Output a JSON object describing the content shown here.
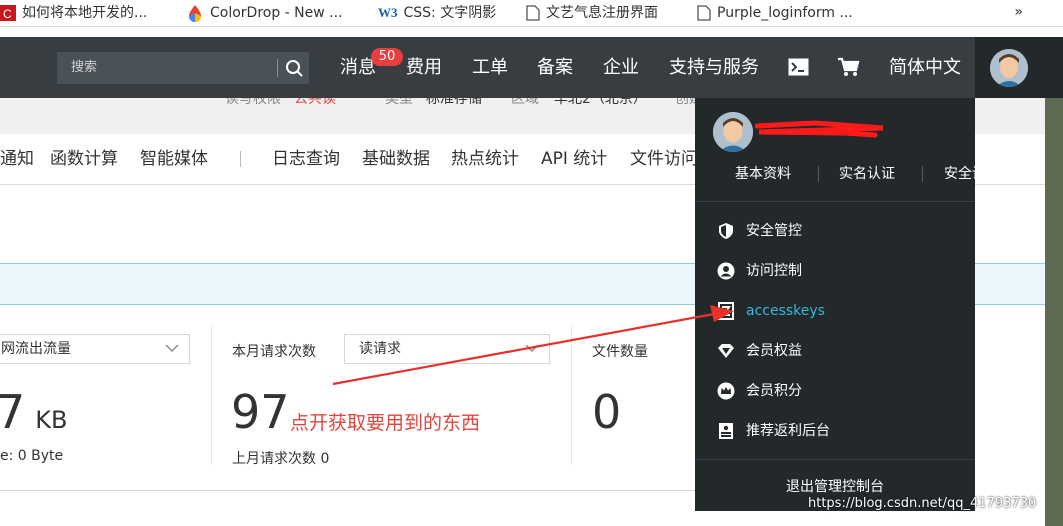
{
  "bookmarks": [
    {
      "label": "如何将本地开发的...",
      "icon": "csdn-icon"
    },
    {
      "label": "ColorDrop - New ...",
      "icon": "colordrop-icon"
    },
    {
      "label": "CSS: 文字阴影",
      "icon": "w3-icon",
      "icon_text": "W3"
    },
    {
      "label": "文艺气息注册界面",
      "icon": "page-icon"
    },
    {
      "label": "Purple_loginform ...",
      "icon": "page-icon"
    }
  ],
  "bookmarks_more": "»",
  "nav": {
    "search_placeholder": "搜索",
    "items": [
      "消息",
      "费用",
      "工单",
      "备案",
      "企业",
      "支持与服务"
    ],
    "badge": "50",
    "language": "简体中文"
  },
  "subinfo": [
    "读写权限",
    "公共读",
    "类型",
    "标准存储",
    "区域",
    "华北2（北京）",
    "创建"
  ],
  "tabs": [
    "通知",
    "函数计算",
    "智能媒体",
    "日志查询",
    "基础数据",
    "热点统计",
    "API 统计",
    "文件访问"
  ],
  "stats": {
    "traffic_select": "网流出流量",
    "traffic_value": "7",
    "traffic_unit": "KB",
    "traffic_sub": "e:  0 Byte",
    "requests_label": "本月请求次数",
    "requests_select": "读请求",
    "requests_value": "97",
    "requests_sub": "上月请求次数  0",
    "files_label": "文件数量",
    "files_value": "0"
  },
  "annotation": "点开获取要用到的东西",
  "dropdown": {
    "links": [
      "基本资料",
      "实名认证",
      "安全设置"
    ],
    "items": [
      {
        "label": "安全管控",
        "icon": "shield-icon"
      },
      {
        "label": "访问控制",
        "icon": "user-icon"
      },
      {
        "label": "accesskeys",
        "icon": "key-icon"
      },
      {
        "label": "会员权益",
        "icon": "diamond-icon"
      },
      {
        "label": "会员积分",
        "icon": "crown-icon"
      },
      {
        "label": "推荐返利后台",
        "icon": "document-icon"
      }
    ],
    "active_color": "#39b6d8",
    "logout": "退出管理控制台"
  },
  "watermark": "https://blog.csdn.net/qq_41793730",
  "colors": {
    "nav_bg": "#373d41",
    "dropdown_bg": "#23282b",
    "accent": "#39b6d8",
    "badge": "#e83e3e",
    "annotation": "#e2453b"
  }
}
